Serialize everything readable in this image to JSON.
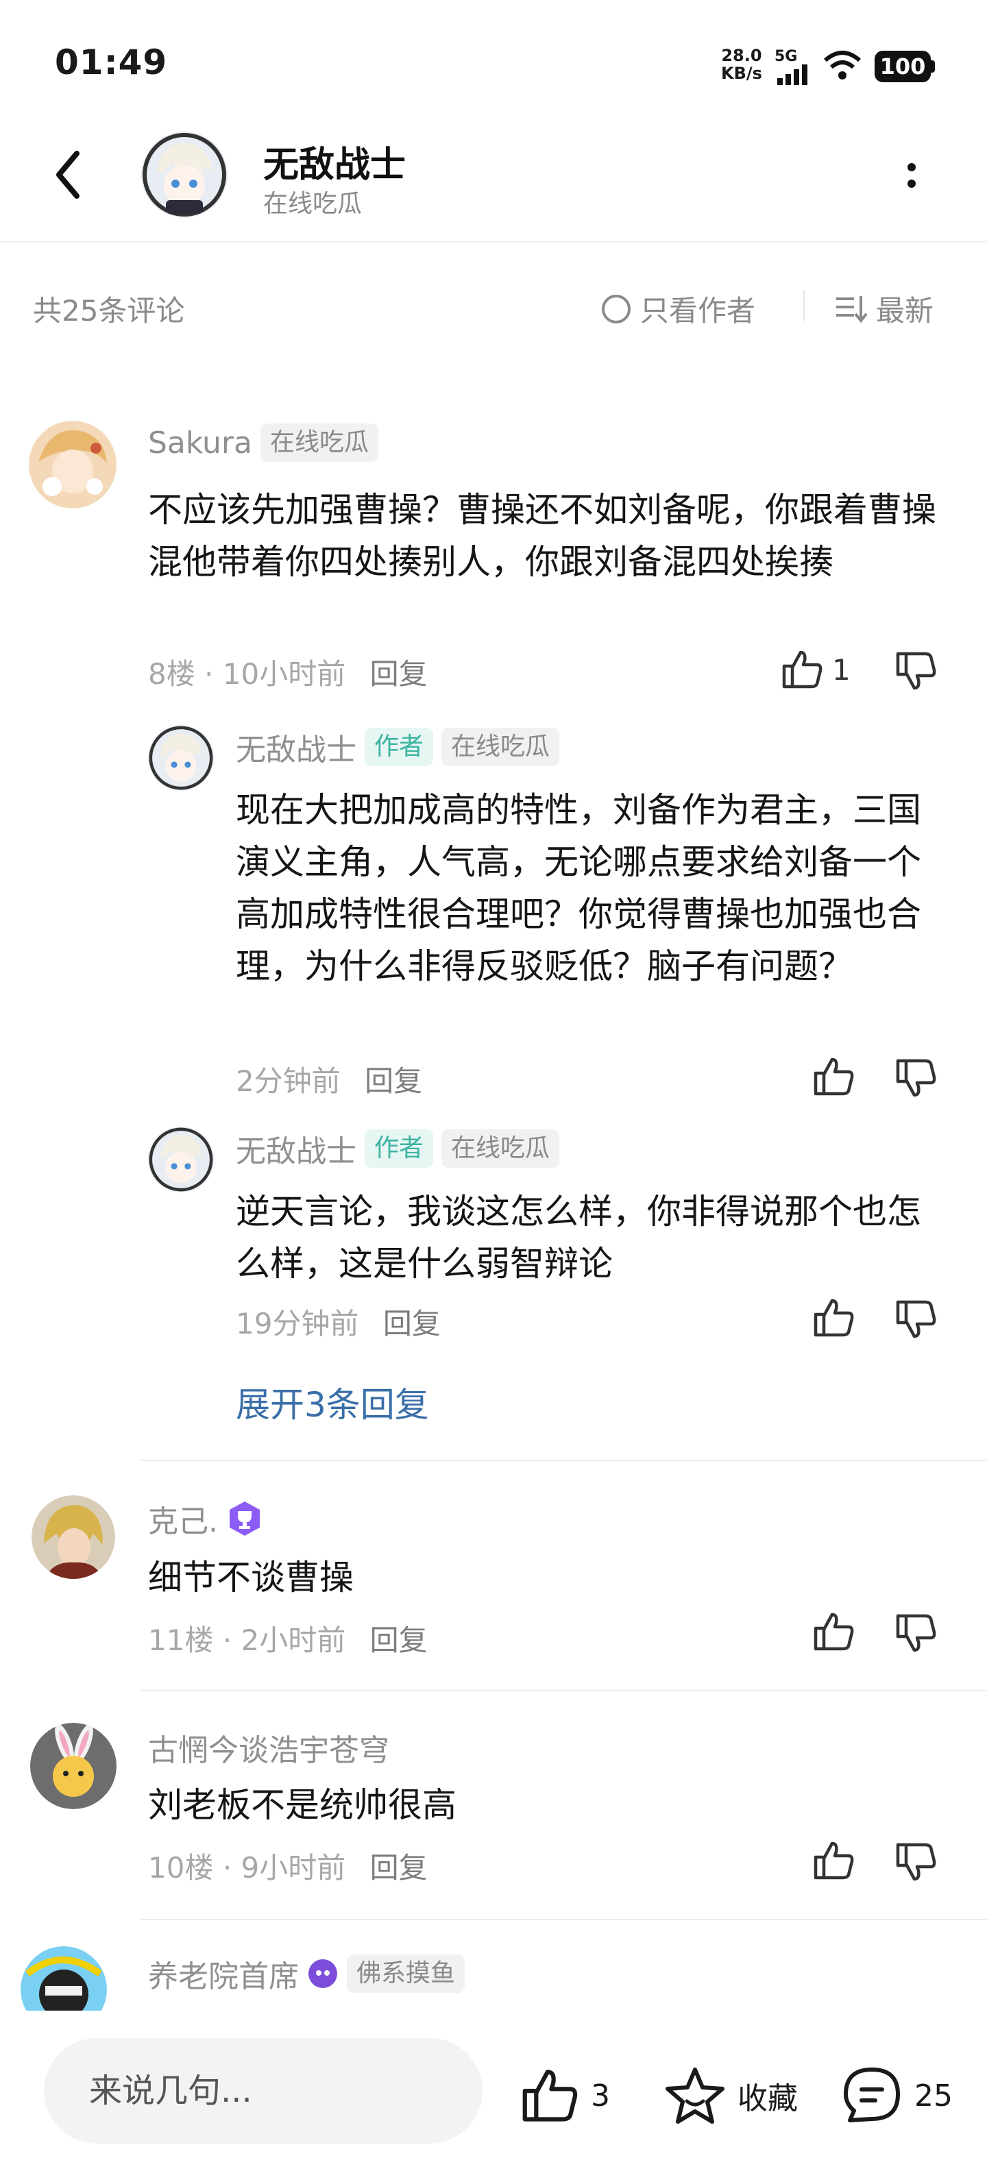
{
  "status_bar": {
    "time": "01:49",
    "net_speed_value": "28.0",
    "net_speed_unit": "KB/s",
    "network": "5G",
    "battery": "100"
  },
  "header": {
    "title": "无敌战士",
    "subtitle": "在线吃瓜",
    "back_icon": "chevron-left-icon",
    "more_icon": "more-vertical-icon"
  },
  "filter": {
    "count_text": "共25条评论",
    "author_only": "只看作者",
    "sort": "最新"
  },
  "comments": [
    {
      "user": "Sakura",
      "tag": "在线吃瓜",
      "text": "不应该先加强曹操？曹操还不如刘备呢，你跟着曹操混他带着你四处揍别人，你跟刘备混四处挨揍",
      "floor": "8楼",
      "time": "10小时前",
      "reply": "回复",
      "likes": "1",
      "replies": [
        {
          "user": "无敌战士",
          "author_tag": "作者",
          "tag": "在线吃瓜",
          "text": "现在大把加成高的特性，刘备作为君主，三国演义主角，人气高，无论哪点要求给刘备一个高加成特性很合理吧？你觉得曹操也加强也合理，为什么非得反驳贬低？脑子有问题？",
          "time": "2分钟前",
          "reply": "回复"
        },
        {
          "user": "无敌战士",
          "author_tag": "作者",
          "tag": "在线吃瓜",
          "text": "逆天言论，我谈这怎么样，你非得说那个也怎么样，这是什么弱智辩论",
          "time": "19分钟前",
          "reply": "回复"
        }
      ],
      "expand": "展开3条回复"
    },
    {
      "user": "克己.",
      "text": "细节不谈曹操",
      "floor": "11楼",
      "time": "2小时前",
      "reply": "回复"
    },
    {
      "user": "古惘今谈浩宇苍穹",
      "text": "刘老板不是统帅很高",
      "floor": "10楼",
      "time": "9小时前",
      "reply": "回复"
    },
    {
      "user": "养老院首席",
      "tag": "佛系摸鱼"
    }
  ],
  "bottom_bar": {
    "input_placeholder": "来说几句...",
    "likes": "3",
    "favorite": "收藏",
    "comments": "25"
  },
  "colors": {
    "author_tag": "#3cb3a3",
    "expand_link": "#3a6fa8",
    "meta_gray": "#a7a7a7"
  }
}
